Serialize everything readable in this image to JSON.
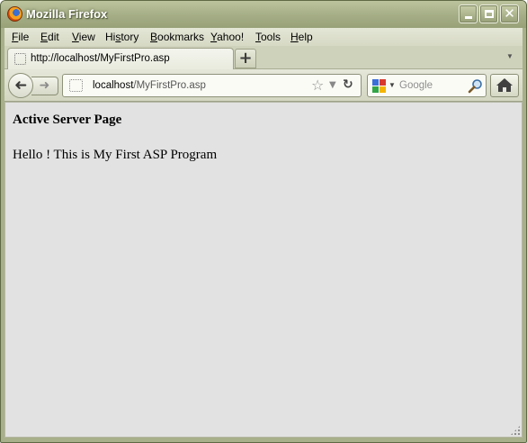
{
  "window": {
    "title": "Mozilla Firefox"
  },
  "menubar": {
    "items": [
      {
        "accel": "F",
        "rest": "ile"
      },
      {
        "accel": "E",
        "rest": "dit"
      },
      {
        "accel": "V",
        "rest": "iew"
      },
      {
        "pre": "Hi",
        "accel": "s",
        "rest": "tory"
      },
      {
        "accel": "B",
        "rest": "ookmarks"
      },
      {
        "accel": "Y",
        "rest": "ahoo!"
      },
      {
        "accel": "T",
        "rest": "ools"
      },
      {
        "accel": "H",
        "rest": "elp"
      }
    ]
  },
  "tabs": {
    "active_title": "http://localhost/MyFirstPro.asp",
    "new_tab_label": "+"
  },
  "navbar": {
    "url_host": "localhost",
    "url_path": "/MyFirstPro.asp",
    "search_placeholder": "Google"
  },
  "page": {
    "heading": "Active Server Page",
    "body": "Hello ! This is My First ASP Program"
  },
  "icons": {
    "app": "firefox-logo-icon",
    "back": "back-arrow-icon",
    "forward": "forward-arrow-icon",
    "bookmark": "star-icon",
    "reload": "reload-icon",
    "search_engine": "google-icon",
    "search": "magnifier-icon",
    "home": "home-icon"
  }
}
